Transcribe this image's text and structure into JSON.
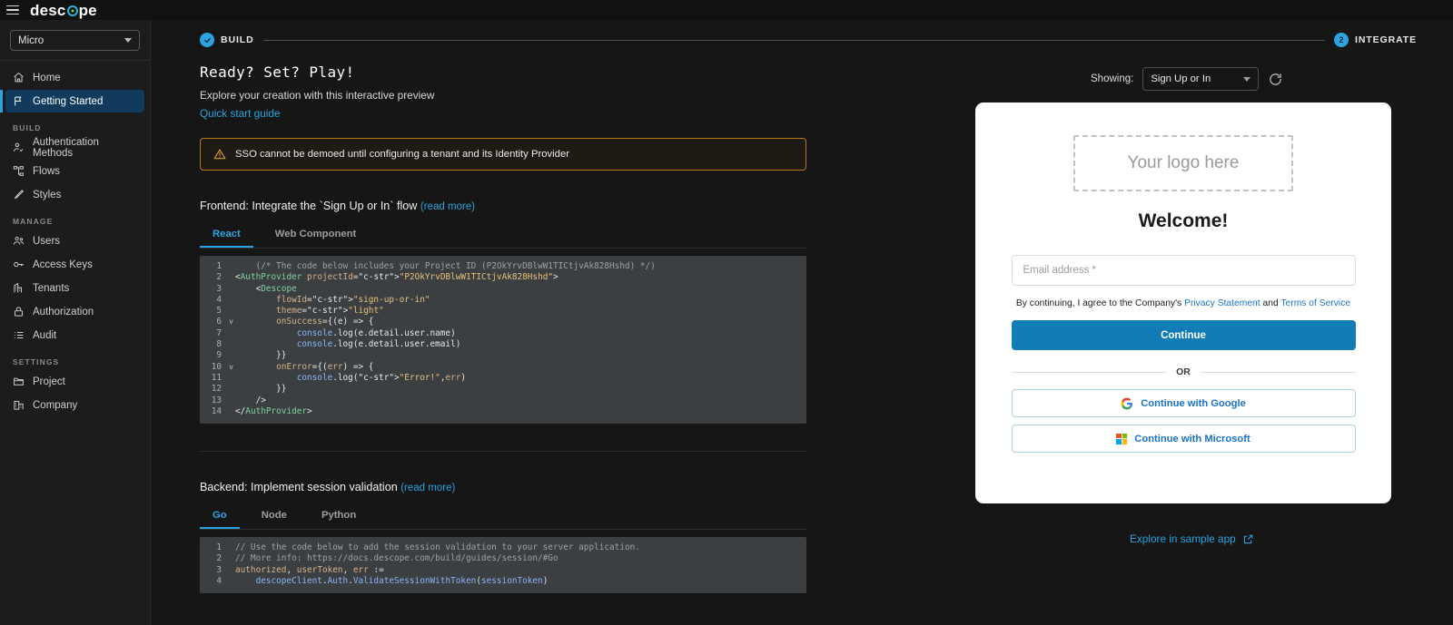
{
  "topbar": {
    "menu_icon": "hamburger-icon",
    "brand": "descope"
  },
  "sidebar": {
    "project": {
      "value": "Micro",
      "icon": "chevron-down-icon"
    },
    "items": [
      {
        "label": "Home",
        "icon": "home-icon",
        "active": false
      },
      {
        "label": "Getting Started",
        "icon": "flag-icon",
        "active": true
      }
    ],
    "sections": [
      {
        "title": "BUILD",
        "items": [
          {
            "label": "Authentication Methods",
            "icon": "user-check-icon"
          },
          {
            "label": "Flows",
            "icon": "flow-icon"
          },
          {
            "label": "Styles",
            "icon": "brush-icon"
          }
        ]
      },
      {
        "title": "MANAGE",
        "items": [
          {
            "label": "Users",
            "icon": "users-icon"
          },
          {
            "label": "Access Keys",
            "icon": "key-icon"
          },
          {
            "label": "Tenants",
            "icon": "building-icon"
          },
          {
            "label": "Authorization",
            "icon": "lock-icon"
          },
          {
            "label": "Audit",
            "icon": "list-icon"
          }
        ]
      },
      {
        "title": "SETTINGS",
        "items": [
          {
            "label": "Project",
            "icon": "folder-icon"
          },
          {
            "label": "Company",
            "icon": "company-icon"
          }
        ]
      }
    ]
  },
  "stepper": {
    "steps": [
      {
        "label": "BUILD",
        "marker": "check",
        "state": "complete"
      },
      {
        "label": "INTEGRATE",
        "marker": "2",
        "state": "current"
      }
    ]
  },
  "main": {
    "title": "Ready? Set? Play!",
    "subtitle": "Explore your creation with this interactive preview",
    "quick_start_link": "Quick start guide",
    "alert": {
      "icon": "warning-triangle-icon",
      "text": "SSO cannot be demoed until configuring a tenant and its Identity Provider",
      "color": "#b8761f"
    },
    "frontend": {
      "heading": "Frontend: Integrate the `Sign Up or In` flow",
      "read_more": "(read more)",
      "tabs": [
        {
          "label": "React",
          "active": true
        },
        {
          "label": "Web Component",
          "active": false
        }
      ],
      "project_id": "P2OkYrvDBlwW1TICtjvAk828Hshd",
      "code_lines": [
        {
          "n": "1",
          "fold": "",
          "text": "    (/* The code below includes your Project ID (P2OkYrvDBlwW1TICtjvAk828Hshd) */)"
        },
        {
          "n": "2",
          "fold": "",
          "text": "<AuthProvider projectId=\"P2OkYrvDBlwW1TICtjvAk828Hshd\">"
        },
        {
          "n": "3",
          "fold": "",
          "text": "    <Descope"
        },
        {
          "n": "4",
          "fold": "",
          "text": "        flowId=\"sign-up-or-in\""
        },
        {
          "n": "5",
          "fold": "",
          "text": "        theme=\"light\""
        },
        {
          "n": "6",
          "fold": "v",
          "text": "        onSuccess={(e) => {"
        },
        {
          "n": "7",
          "fold": "",
          "text": "            console.log(e.detail.user.name)"
        },
        {
          "n": "8",
          "fold": "",
          "text": "            console.log(e.detail.user.email)"
        },
        {
          "n": "9",
          "fold": "",
          "text": "        }}"
        },
        {
          "n": "10",
          "fold": "v",
          "text": "        onError={(err) => {"
        },
        {
          "n": "11",
          "fold": "",
          "text": "            console.log(\"Error!\", err)"
        },
        {
          "n": "12",
          "fold": "",
          "text": "        }}"
        },
        {
          "n": "13",
          "fold": "",
          "text": "    />"
        },
        {
          "n": "14",
          "fold": "",
          "text": "</AuthProvider>"
        }
      ]
    },
    "backend": {
      "heading": "Backend: Implement session validation",
      "read_more": "(read more)",
      "tabs": [
        {
          "label": "Go",
          "active": true
        },
        {
          "label": "Node",
          "active": false
        },
        {
          "label": "Python",
          "active": false
        }
      ],
      "code_lines": [
        {
          "n": "1",
          "fold": "",
          "text": "// Use the code below to add the session validation to your server application."
        },
        {
          "n": "2",
          "fold": "",
          "text": "// More info: https://docs.descope.com/build/guides/session/#Go"
        },
        {
          "n": "3",
          "fold": "",
          "text": "authorized, userToken, err :="
        },
        {
          "n": "4",
          "fold": "",
          "text": "    descopeClient.Auth.ValidateSessionWithToken(sessionToken)"
        }
      ]
    }
  },
  "preview": {
    "showing_label": "Showing:",
    "showing_value": "Sign Up or In",
    "refresh_icon": "refresh-icon",
    "logo_placeholder": "Your logo here",
    "welcome": "Welcome!",
    "email_placeholder": "Email address *",
    "legal_prefix": "By continuing, I agree to the Company's",
    "legal_privacy": "Privacy Statement",
    "legal_and": "and",
    "legal_terms": "Terms of Service",
    "continue_label": "Continue",
    "or_label": "OR",
    "google_label": "Continue with Google",
    "microsoft_label": "Continue with Microsoft",
    "explore_label": "Explore in sample app",
    "explore_icon": "external-link-icon",
    "accent": "#117cb5"
  }
}
